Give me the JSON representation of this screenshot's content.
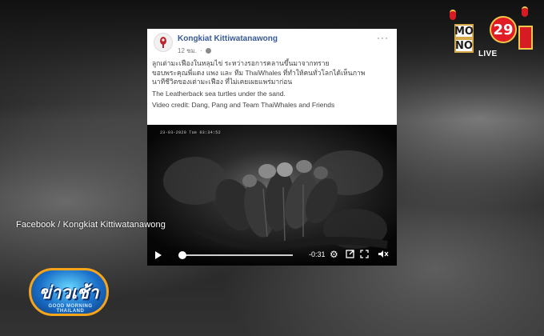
{
  "post": {
    "author": "Kongkiat Kittiwatanawong",
    "time": "12 ชม.",
    "more": "···",
    "text_thai_line1": "ลูกเต่ามะเฟืองในหลุมไข่ ระหว่างรอการคลานขึ้นมาจากทราย",
    "text_thai_line2": "ขอบพระคุณพี่แดง แพง และ ทีม ThaiWhales ที่ทำให้คนทั่วโลกได้เห็นภาพ",
    "text_thai_line3": "นาทีชีวิตของเต่ามะเฟือง ที่ไม่เคยเผยแพร่มาก่อน",
    "text_en": "The Leatherback sea turtles under the sand.",
    "credit": "Video credit: Dang, Pang and Team ThaiWhales and Friends"
  },
  "video": {
    "timestamp": "23-03-2020  Tue  03:34:52",
    "time_remaining": "-0:31",
    "progress": 0.03
  },
  "overlay": {
    "source": "Facebook / Kongkiat  Kittiwatanawong"
  },
  "channel": {
    "mono_letters": [
      "MO",
      "NO"
    ],
    "number": "29",
    "live": "LIVE"
  },
  "program": {
    "title": "ข่าวเช้า",
    "subtitle": "GOOD MORNING THAILAND"
  },
  "colors": {
    "author_link": "#385898",
    "channel_red": "#e21c24",
    "program_blue": "#1a6fc8",
    "program_orange": "#f6a51b"
  }
}
